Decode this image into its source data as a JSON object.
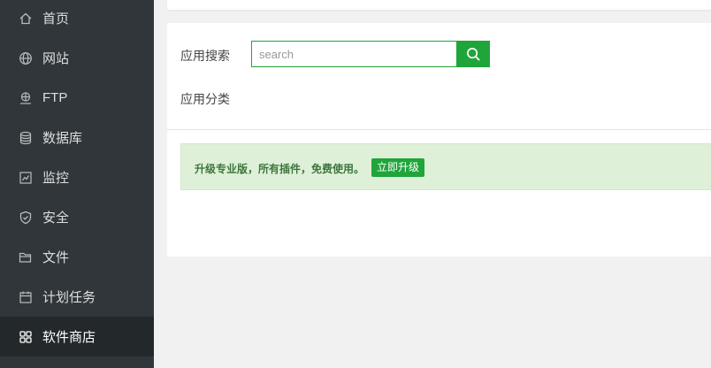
{
  "sidebar": {
    "items": [
      {
        "label": "首页",
        "icon": "home-icon"
      },
      {
        "label": "网站",
        "icon": "globe-icon"
      },
      {
        "label": "FTP",
        "icon": "ftp-icon"
      },
      {
        "label": "数据库",
        "icon": "database-icon"
      },
      {
        "label": "监控",
        "icon": "monitor-icon"
      },
      {
        "label": "安全",
        "icon": "shield-icon"
      },
      {
        "label": "文件",
        "icon": "folder-icon"
      },
      {
        "label": "计划任务",
        "icon": "calendar-icon"
      },
      {
        "label": "软件商店",
        "icon": "grid-icon",
        "active": true
      }
    ]
  },
  "store": {
    "search_label": "应用搜索",
    "search_placeholder": "search",
    "category_label": "应用分类",
    "upgrade_text": "升级专业版，所有插件，免费使用。",
    "upgrade_button": "立即升级"
  },
  "colors": {
    "sidebar_bg": "#30363a",
    "sidebar_active_bg": "#23282b",
    "accent": "#20a53a",
    "notice_bg": "#dff0d8",
    "notice_text": "#3c763d"
  }
}
